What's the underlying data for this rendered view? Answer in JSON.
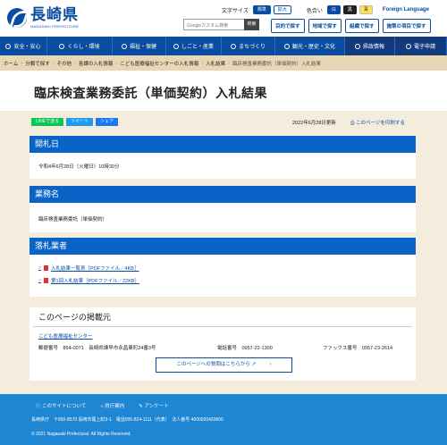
{
  "header": {
    "logo_jp": "長崎県",
    "logo_en": "NAGASAKI PREFECTURE",
    "font_size_label": "文字サイズ",
    "font_standard": "標準",
    "font_large": "拡大",
    "color_label": "色合い",
    "color_white": "白",
    "color_black": "黒",
    "color_blue": "青",
    "foreign_language": "Foreign Language",
    "search_placeholder": "Googleカスタム検索",
    "search_button": "検索",
    "buttons": [
      "目的で探す",
      "地域で探す",
      "組織で探す",
      "施策の項目で探す"
    ]
  },
  "nav": [
    "安全・安心",
    "くらし・環境",
    "福祉・保健",
    "しごと・産業",
    "まちづくり",
    "観光・歴史・文化",
    "県政情報",
    "電子申請"
  ],
  "breadcrumb": [
    "ホーム",
    "分類で探す",
    "その他",
    "各課の入札情報",
    "こども医療福祉センターの入札情報",
    "入札結果",
    "臨床検査業務委託（単価契約）入札結果"
  ],
  "page": {
    "title": "臨床検査業務委託（単価契約）入札結果",
    "share_line": "LINEで送る",
    "share_tweet": "ツイート",
    "share_fb": "シェア",
    "updated": "2022年6月28日更新",
    "print": "このページを印刷する"
  },
  "sections": {
    "open_date_title": "開札日",
    "open_date_value": "令和4年6月28日（火曜日）10時30分",
    "service_title": "業務名",
    "service_value": "臨床検査業務委託（単価契約）",
    "winner_title": "落札業者",
    "links": [
      "入札結果一覧表［PDFファイル／4KB］",
      "第1回入札結果［PDFファイル／22KB］"
    ]
  },
  "publisher": {
    "heading": "このページの掲載元",
    "org": "こども医療福祉センター",
    "postal": "郵便番号　854-0071　長崎県諫早市永昌東町24番3号",
    "phone": "電話番号　0957-22-1300",
    "fax": "ファックス番号　0957-23-2614",
    "contact_button": "このページへの質問はこちらから"
  },
  "footer": {
    "links": [
      "このサイトについて",
      "県庁案内",
      "アンケート"
    ],
    "address": "長崎県庁　〒850-8570 長崎市尾上町3-1　電話095-824-1111（代表）　法人番号 4000020420000",
    "copyright": "© 2021 Nagasaki Prefectural. All Rights Reserved."
  },
  "colors": {
    "brand": "#0a4da0",
    "section_header": "#0a64c8",
    "footer": "#1e86d2",
    "background": "#f4ecdc"
  }
}
